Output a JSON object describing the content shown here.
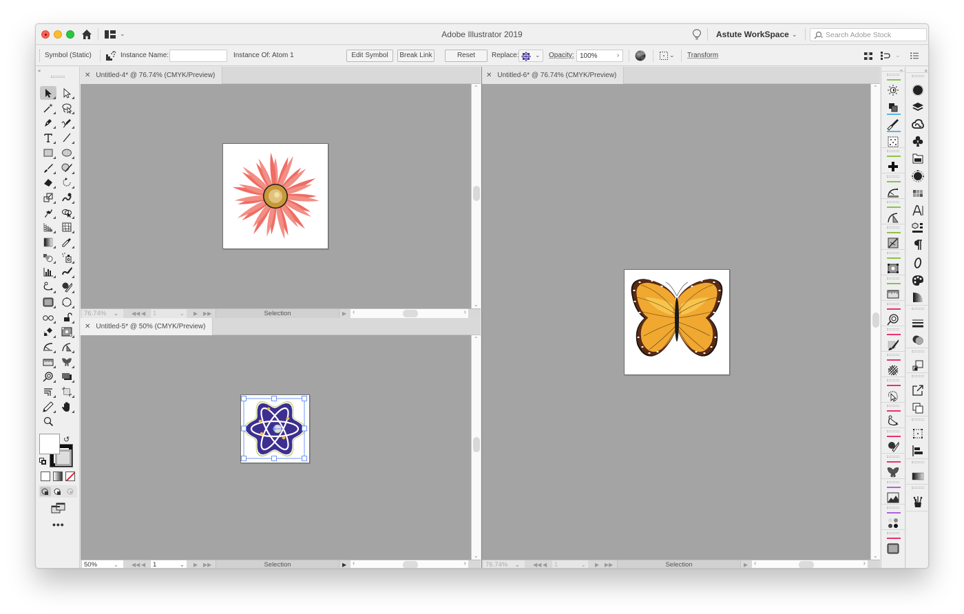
{
  "titlebar": {
    "app_title": "Adobe Illustrator 2019",
    "workspace": "Astute WorkSpace",
    "stock_search_placeholder": "Search Adobe Stock"
  },
  "controlbar": {
    "selection_type": "Symbol (Static)",
    "instance_name_label": "Instance Name:",
    "instance_name_value": "",
    "instance_of_label": "Instance Of:",
    "instance_of_value": "Atom 1",
    "edit_symbol": "Edit Symbol",
    "break_link": "Break Link",
    "reset": "Reset",
    "replace_label": "Replace:",
    "opacity_label": "Opacity:",
    "opacity_value": "100%",
    "transform_label": "Transform"
  },
  "tools": [
    "selection-tool",
    "direct-selection-tool",
    "magic-wand-tool",
    "lasso-tool",
    "pen-tool",
    "curvature-tool",
    "type-tool",
    "line-segment-tool",
    "rectangle-tool",
    "ellipse-tool",
    "paintbrush-tool",
    "blob-brush-tool",
    "eraser-tool",
    "rotate-tool",
    "scale-tool",
    "warp-tool",
    "puppet-warp-tool",
    "shape-builder-tool",
    "perspective-grid-tool",
    "mesh-tool",
    "gradient-tool",
    "eyedropper-tool",
    "blend-tool",
    "symbol-sprayer-tool",
    "column-graph-tool",
    "stylism-tool",
    "dynamic-sketch-tool",
    "smart-remove-brush-tool",
    "texture-tool",
    "circle-by-points-tool",
    "infinite-lines-tool",
    "unlock-tool",
    "snap-to-collinear-tool",
    "dynamic-corners-tool",
    "arc-by-points-tool",
    "angle-tool",
    "measure-tool",
    "mirror-me-tool",
    "vector-first-aid-tool",
    "shadow-tool",
    "offset-tool",
    "crop-tool",
    "pencil-tool",
    "hand-tool",
    "zoom-tool"
  ],
  "documents": [
    {
      "tab_title": "Untitled-4* @ 76.74% (CMYK/Preview)",
      "zoom": "76.74%",
      "page": "1",
      "status": "Selection",
      "artwork": "flower",
      "active": false
    },
    {
      "tab_title": "Untitled-5* @ 50% (CMYK/Preview)",
      "zoom": "50%",
      "page": "1",
      "status": "Selection",
      "artwork": "atom",
      "active": true
    },
    {
      "tab_title": "Untitled-6* @ 76.74% (CMYK/Preview)",
      "zoom": "76.74%",
      "page": "1",
      "status": "Selection",
      "artwork": "butterfly",
      "active": false
    }
  ],
  "right_panel_1": [
    "brightness-icon",
    "arrange-icon",
    "brush-icon",
    "dot-grid-icon",
    "plus-icon",
    "arc-icon",
    "angle-icon",
    "diagonal-icon",
    "selection-box-icon",
    "ruler-icon",
    "spiral-icon",
    "texture-brush-icon",
    "hatch-icon",
    "cursor-path-icon",
    "lasso-path-icon",
    "smart-brush-icon",
    "butterfly-icon",
    "landscape-icon",
    "dots-icon",
    "noise-texture-icon"
  ],
  "right_panel_2": [
    "appearance-icon",
    "layers-icon",
    "cc-libraries-icon",
    "symbols-icon",
    "asset-export-icon",
    "artboards-icon",
    "swatches-icon",
    "character-icon",
    "3d-icon",
    "paragraph-icon",
    "opentype-icon",
    "color-icon",
    "color-guide-icon",
    "stroke-icon",
    "transparency-icon",
    "transform-icon",
    "export-icon",
    "pathfinder-icon",
    "align-bounds-icon",
    "align-icon",
    "gradient-icon",
    "brushes-icon"
  ],
  "colors": {
    "canvas": "#a4a4a4",
    "selection_blue": "#4a7bf7",
    "flower_petal": "#ef6d64",
    "flower_center": "#c9983a",
    "atom_purple": "#3c2f8f",
    "butterfly_orange": "#f0a830",
    "butterfly_border": "#5a2a14"
  }
}
